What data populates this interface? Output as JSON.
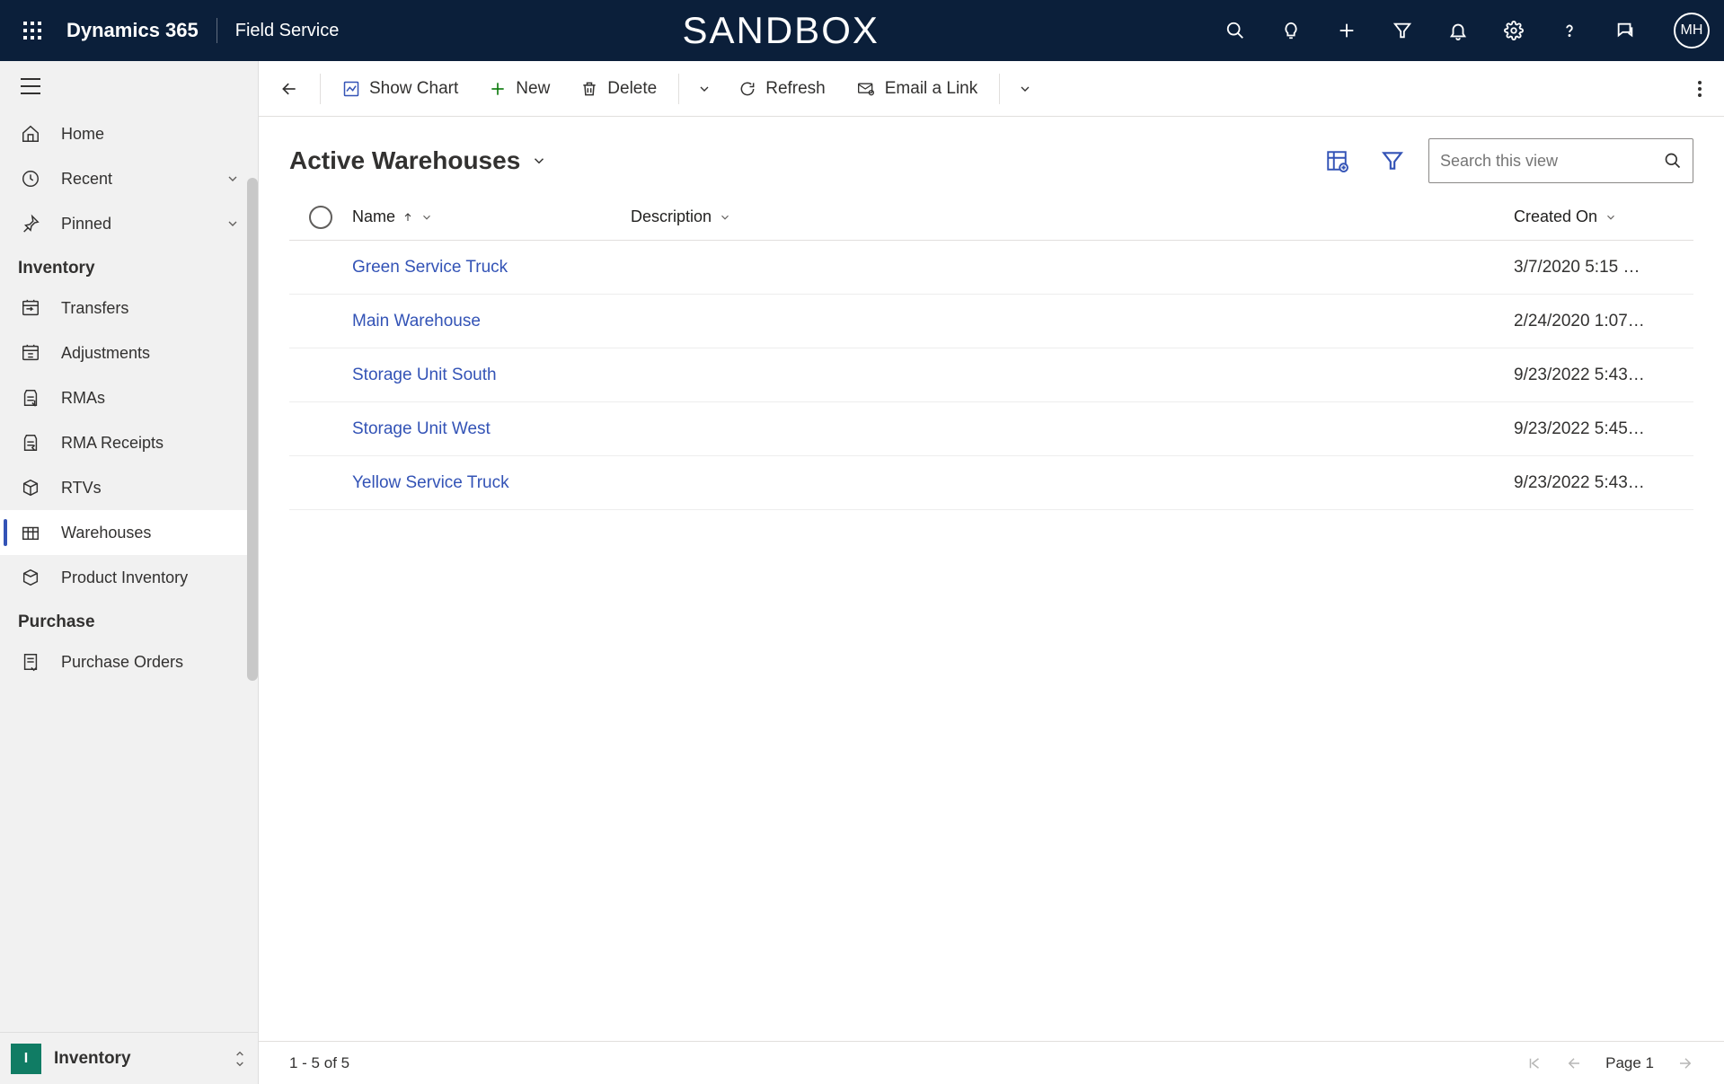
{
  "topbar": {
    "brand": "Dynamics 365",
    "app": "Field Service",
    "env": "SANDBOX",
    "avatar_initials": "MH"
  },
  "sidebar": {
    "nav": {
      "home": "Home",
      "recent": "Recent",
      "pinned": "Pinned"
    },
    "groups": [
      {
        "label": "Inventory",
        "items": [
          {
            "key": "transfers",
            "label": "Transfers"
          },
          {
            "key": "adjustments",
            "label": "Adjustments"
          },
          {
            "key": "rmas",
            "label": "RMAs"
          },
          {
            "key": "rma-receipts",
            "label": "RMA Receipts"
          },
          {
            "key": "rtvs",
            "label": "RTVs"
          },
          {
            "key": "warehouses",
            "label": "Warehouses",
            "selected": true
          },
          {
            "key": "product-inventory",
            "label": "Product Inventory"
          }
        ]
      },
      {
        "label": "Purchase",
        "items": [
          {
            "key": "purchase-orders",
            "label": "Purchase Orders"
          }
        ]
      }
    ],
    "footer": {
      "badge": "I",
      "label": "Inventory"
    }
  },
  "commandbar": {
    "show_chart": "Show Chart",
    "new": "New",
    "delete": "Delete",
    "refresh": "Refresh",
    "email_link": "Email a Link"
  },
  "view": {
    "title": "Active Warehouses",
    "search_placeholder": "Search this view"
  },
  "grid": {
    "columns": {
      "name": "Name",
      "description": "Description",
      "created_on": "Created On"
    },
    "rows": [
      {
        "name": "Green Service Truck",
        "description": "",
        "created_on": "3/7/2020 5:15 …"
      },
      {
        "name": "Main Warehouse",
        "description": "",
        "created_on": "2/24/2020 1:07…"
      },
      {
        "name": "Storage Unit South",
        "description": "",
        "created_on": "9/23/2022 5:43…"
      },
      {
        "name": "Storage Unit West",
        "description": "",
        "created_on": "9/23/2022 5:45…"
      },
      {
        "name": "Yellow Service Truck",
        "description": "",
        "created_on": "9/23/2022 5:43…"
      }
    ]
  },
  "footer": {
    "range": "1 - 5 of 5",
    "page": "Page 1"
  }
}
